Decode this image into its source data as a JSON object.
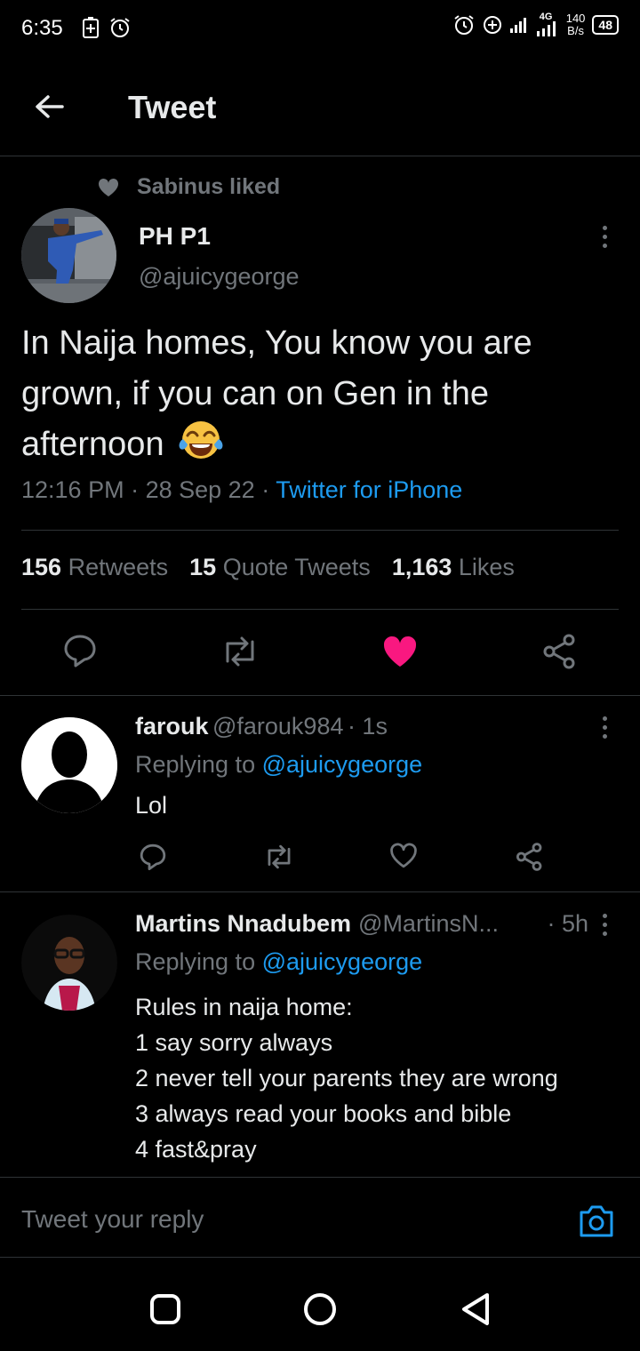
{
  "status_bar": {
    "time": "6:35",
    "speed_value": "140",
    "speed_unit": "B/s",
    "network": "4G",
    "battery": "48"
  },
  "header": {
    "title": "Tweet"
  },
  "social_context": {
    "text": "Sabinus liked"
  },
  "tweet": {
    "name": "PH P1",
    "handle": "@ajuicygeorge",
    "text": "In Naija homes, You know you are grown, if you can on Gen in the afternoon",
    "emoji": "😂",
    "time": "12:16 PM",
    "date": "28 Sep 22",
    "source": "Twitter for iPhone",
    "retweets_count": "156",
    "retweets_label": "Retweets",
    "quotes_count": "15",
    "quotes_label": "Quote Tweets",
    "likes_count": "1,163",
    "likes_label": "Likes",
    "liked": true
  },
  "replies": [
    {
      "name": "farouk",
      "handle": "@farouk984",
      "time": "· 1s",
      "replying_prefix": "Replying to",
      "replying_to": "@ajuicygeorge",
      "lines": [
        "Lol"
      ]
    },
    {
      "name": "Martins Nnadubem",
      "handle": "@MartinsN...",
      "time": "· 5h",
      "replying_prefix": "Replying to",
      "replying_to": "@ajuicygeorge",
      "lines": [
        "Rules in naija home:",
        "1 say sorry always",
        "2 never tell your parents they are wrong",
        "3 always read your books and bible",
        "4 fast&pray"
      ]
    }
  ],
  "compose": {
    "placeholder": "Tweet your reply"
  },
  "colors": {
    "accent": "#1d9bf0",
    "like": "#f91880",
    "background": "#000000"
  }
}
